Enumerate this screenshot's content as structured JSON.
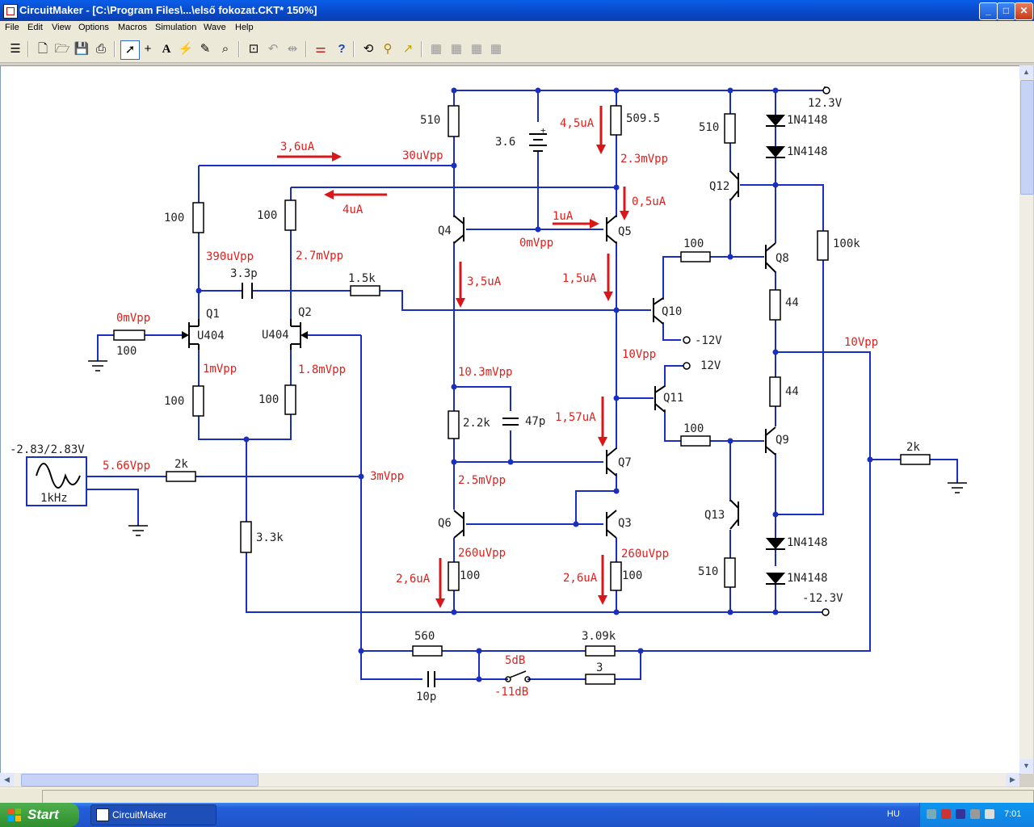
{
  "window": {
    "title": "CircuitMaker - [C:\\Program Files\\...\\első fokozat.CKT* 150%]",
    "controls": {
      "minimize": "_",
      "maximize": "□",
      "close": "✕"
    }
  },
  "menu": [
    "File",
    "Edit",
    "View",
    "Options",
    "Macros",
    "Simulation",
    "Wave",
    "Help"
  ],
  "toolbar": {
    "icons": [
      "library-icon",
      "new-icon",
      "open-icon",
      "save-icon",
      "print-icon",
      "arrow-tool-icon",
      "wire-tool-icon",
      "text-tool-icon",
      "probe-tool-icon",
      "delete-tool-icon",
      "zoom-tool-icon",
      "zoom-fit-icon",
      "rotate-icon",
      "mirror-icon",
      "digital-sim-icon",
      "help-icon",
      "undo-icon",
      "reset-icon",
      "step-icon",
      "macro1-icon",
      "macro2-icon",
      "macro3-icon",
      "macro4-icon"
    ]
  },
  "schematic": {
    "component_labels": {
      "r510_top": "510",
      "bat": "3.6",
      "r5095": "509.5",
      "r510_right": "510",
      "d1": "1N4148",
      "d2": "1N4148",
      "q12": "Q12",
      "r100k": "100k",
      "r100_left_top": "100",
      "r100_mid_top": "100",
      "q4": "Q4",
      "q5": "Q5",
      "r100_q8": "100",
      "q8": "Q8",
      "r44_top": "44",
      "cap33p": "3.3p",
      "r15k": "1.5k",
      "q10": "Q10",
      "neg12": "-12V",
      "q1": "Q1",
      "q2": "Q2",
      "u404_1": "U404",
      "u404_2": "U404",
      "r100_input": "100",
      "pos12": "12V",
      "q11": "Q11",
      "r44_bot": "44",
      "r100_left_bot": "100",
      "r100_mid_bot": "100",
      "r22k": "2.2k",
      "cap47p": "47p",
      "q7": "Q7",
      "r100_q9": "100",
      "q9": "Q9",
      "src_amp": "-2.83/2.83V",
      "src_freq": "1kHz",
      "r2k_in": "2k",
      "r2k_load": "2k",
      "q6": "Q6",
      "q3": "Q3",
      "q13": "Q13",
      "r33k": "3.3k",
      "r100_q6": "100",
      "r100_q3": "100",
      "r510_bot": "510",
      "d3": "1N4148",
      "d4": "1N4148",
      "vneg": "-12.3V",
      "vpos": "12.3V",
      "r560": "560",
      "r309k": "3.09k",
      "cap10p": "10p",
      "r3": "3"
    },
    "annotations": {
      "i36": "3,6uA",
      "v30u": "30uVpp",
      "i45": "4,5uA",
      "v23m": "2.3mVpp",
      "i4": "4uA",
      "i05": "0,5uA",
      "i1": "1uA",
      "v0m_mid": "0mVpp",
      "v390u": "390uVpp",
      "v27m": "2.7mVpp",
      "i35": "3,5uA",
      "i15": "1,5uA",
      "v0m_in": "0mVpp",
      "v1m": "1mVpp",
      "v18m": "1.8mVpp",
      "v10": "10Vpp",
      "v10_out": "10Vpp",
      "v103m": "10.3mVpp",
      "i157": "1,57uA",
      "v566": "5.66Vpp",
      "v3m": "3mVpp",
      "v25m": "2.5mVpp",
      "v260u_l": "260uVpp",
      "v260u_r": "260uVpp",
      "i26_l": "2,6uA",
      "i26_r": "2,6uA",
      "db5": "5dB",
      "db11": "-11dB"
    }
  },
  "taskbar": {
    "start": "Start",
    "task": "CircuitMaker",
    "lang": "HU",
    "clock": "7:01"
  }
}
